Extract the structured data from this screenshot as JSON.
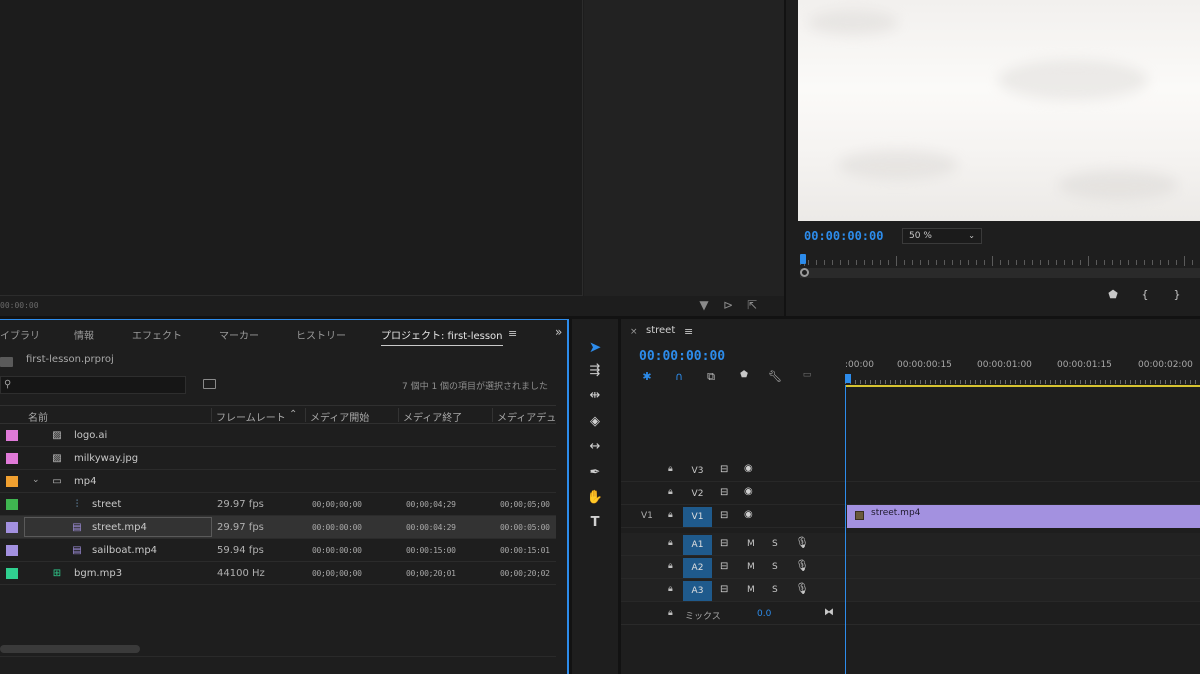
{
  "source_monitor": {
    "timecode": "00:00:00",
    "icons": [
      "filter-icon",
      "insert-icon",
      "export-frame-icon"
    ]
  },
  "program_monitor": {
    "timecode": "00:00:00:00",
    "zoom": "50 %",
    "controls": [
      "add-marker-icon",
      "mark-in-icon",
      "mark-out-icon"
    ]
  },
  "project_panel": {
    "tabs": [
      "イブラリ",
      "情報",
      "エフェクト",
      "マーカー",
      "ヒストリー",
      "プロジェクト: first-lesson"
    ],
    "active_tab": "プロジェクト: first-lesson",
    "project_file": "first-lesson.prproj",
    "selection_status": "7 個中 1 個の項目が選択されました",
    "columns": [
      "名前",
      "フレームレート",
      "メディア開始",
      "メディア終了",
      "メディアデュ"
    ],
    "rows": [
      {
        "name": "logo.ai",
        "color": "#e07ad8",
        "type": "image",
        "fps": "",
        "start": "",
        "end": "",
        "duration": ""
      },
      {
        "name": "milkyway.jpg",
        "color": "#e07ad8",
        "type": "image",
        "fps": "",
        "start": "",
        "end": "",
        "duration": ""
      },
      {
        "name": "mp4",
        "color": "#f0a030",
        "type": "folder",
        "fps": "",
        "start": "",
        "end": "",
        "duration": ""
      },
      {
        "name": "street",
        "color": "#3fb550",
        "type": "sequence",
        "fps": "29.97 fps",
        "start": "00;00;00;00",
        "end": "00;00;04;29",
        "duration": "00;00;05;00"
      },
      {
        "name": "street.mp4",
        "color": "#a391e0",
        "type": "video",
        "fps": "29.97 fps",
        "start": "00:00:00:00",
        "end": "00:00:04:29",
        "duration": "00:00:05:00"
      },
      {
        "name": "sailboat.mp4",
        "color": "#a391e0",
        "type": "video",
        "fps": "59.94 fps",
        "start": "00:00:00:00",
        "end": "00:00:15:00",
        "duration": "00:00:15:01"
      },
      {
        "name": "bgm.mp3",
        "color": "#30d090",
        "type": "audio",
        "fps": "44100 Hz",
        "start": "00;00;00;00",
        "end": "00;00;20;01",
        "duration": "00;00;20;02"
      }
    ]
  },
  "tools": [
    "selection-tool",
    "track-select-tool",
    "ripple-edit-tool",
    "razor-tool",
    "slip-tool",
    "pen-tool",
    "hand-tool",
    "type-tool"
  ],
  "timeline": {
    "sequence_name": "street",
    "timecode": "00:00:00:00",
    "ruler_labels": [
      ":00:00",
      "00:00:00:15",
      "00:00:01:00",
      "00:00:01:15",
      "00:00:02:00"
    ],
    "video_tracks": [
      {
        "name": "V3",
        "source": ""
      },
      {
        "name": "V2",
        "source": ""
      },
      {
        "name": "V1",
        "source": "V1"
      }
    ],
    "audio_tracks": [
      {
        "name": "A1",
        "m": "M",
        "s": "S"
      },
      {
        "name": "A2",
        "m": "M",
        "s": "S"
      },
      {
        "name": "A3",
        "m": "M",
        "s": "S"
      }
    ],
    "clip": {
      "label": "street.mp4",
      "color": "#a391e0"
    },
    "mix_label": "ミックス",
    "mix_value": "0.0"
  }
}
